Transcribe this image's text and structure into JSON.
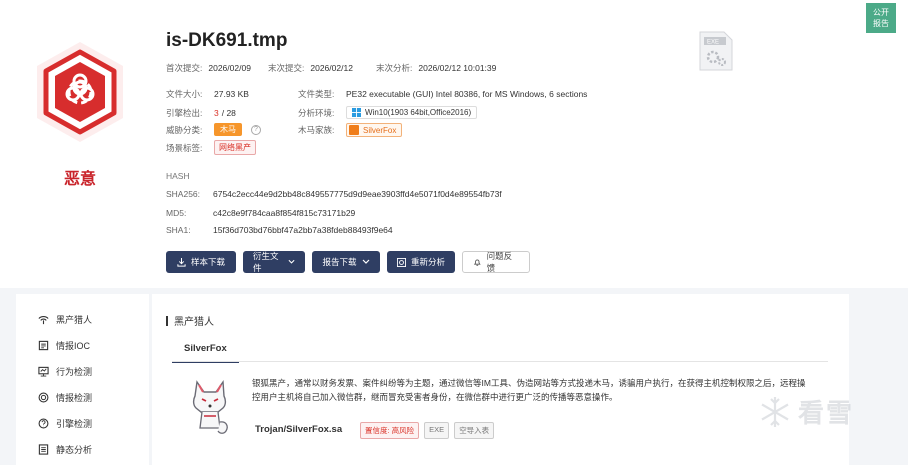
{
  "verdict": {
    "label": "恶意",
    "icon": "biohazard-icon"
  },
  "file": {
    "name": "is-DK691.tmp"
  },
  "dates": {
    "first_submit_label": "首次提交:",
    "first_submit": "2026/02/09",
    "last_submit_label": "末次提交:",
    "last_submit": "2026/02/12",
    "last_analysis_label": "末次分析:",
    "last_analysis": "2026/02/12 10:01:39"
  },
  "details": {
    "size_label": "文件大小:",
    "size": "27.93 KB",
    "engine_label": "引擎检出:",
    "engine_hits": "3",
    "engine_total": "/ 28",
    "threat_label": "威胁分类:",
    "threat": "木马",
    "scene_label": "场景标签:",
    "scene": "网络黑产",
    "type_label": "文件类型:",
    "type": "PE32 executable (GUI) Intel 80386, for MS Windows, 6 sections",
    "env_label": "分析环境:",
    "env": "Win10(1903 64bit,Office2016)",
    "family_label": "木马家族:",
    "family": "SilverFox"
  },
  "hash": {
    "title": "HASH",
    "sha256_label": "SHA256:",
    "sha256": "6754c2ecc44e9d2bb48c849557775d9d9eae3903ffd4e5071f0d4e89554fb73f",
    "md5_label": "MD5:",
    "md5": "c42c8e9f784caa8f854f815c73171b29",
    "sha1_label": "SHA1:",
    "sha1": "15f36d703bd76bbf47a2bb7a38fdeb88493f9e64"
  },
  "actions": {
    "sample_download": "样本下载",
    "derived_files": "衍生文件",
    "report_download": "报告下载",
    "reanalyze": "重新分析",
    "feedback": "问题反馈"
  },
  "thumb": {
    "label": "EXE"
  },
  "corner": {
    "line1": "公开",
    "line2": "报告"
  },
  "sidebar": {
    "items": [
      {
        "label": "黑产猎人",
        "icon": "blackmarket-icon"
      },
      {
        "label": "情报IOC",
        "icon": "ioc-icon"
      },
      {
        "label": "行为检测",
        "icon": "behavior-icon"
      },
      {
        "label": "情报检测",
        "icon": "intel-icon"
      },
      {
        "label": "引擎检测",
        "icon": "engine-icon"
      },
      {
        "label": "静态分析",
        "icon": "static-icon"
      }
    ]
  },
  "section": {
    "title": "黑产猎人",
    "tab": "SilverFox",
    "description": "银狐黑产，通常以财务发票、案件纠纷等为主题，通过微信等IM工具、伪造网站等方式投递木马，诱骗用户执行，在获得主机控制权限之后，远程操控用户主机将自己加入微信群，继而冒充受害者身份，在微信群中进行更广泛的传播等恶意操作。",
    "family_name": "Trojan/SilverFox.sa",
    "badges": [
      "置信度: 高风险",
      "EXE",
      "空导入表"
    ]
  },
  "watermark": {
    "text": "看雪"
  },
  "colors": {
    "malicious": "#c9242b",
    "primary": "#2f3e63",
    "accent_orange": "#f6962b",
    "corner_green": "#4caa88"
  }
}
